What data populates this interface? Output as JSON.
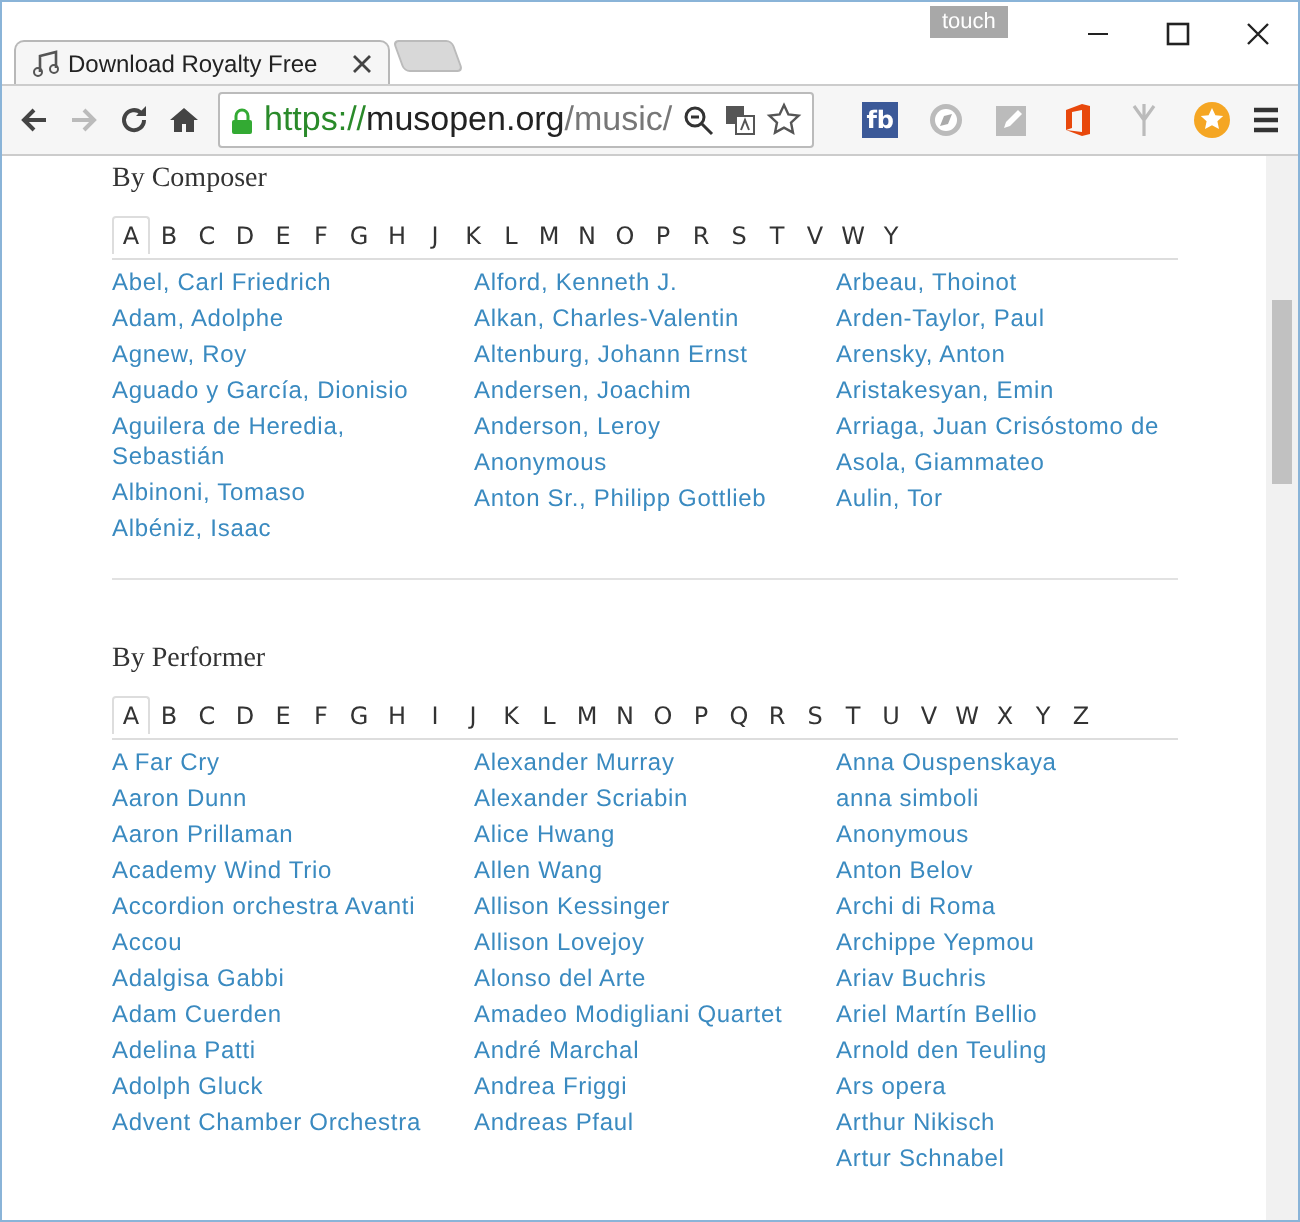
{
  "window": {
    "badge": "touch"
  },
  "tabs": [
    {
      "title": "Download Royalty Free",
      "selected": true
    }
  ],
  "toolbar": {
    "forward_disabled": true,
    "url": {
      "scheme": "https://",
      "host": "musopen.org",
      "path": "/music/"
    },
    "extensions": [
      {
        "kind": "text",
        "label": "fb"
      },
      {
        "kind": "compass"
      },
      {
        "kind": "edit"
      },
      {
        "kind": "office"
      },
      {
        "kind": "fork"
      },
      {
        "kind": "coin"
      }
    ]
  },
  "sections": [
    {
      "title": "By Composer",
      "letters": [
        {
          "label": "A",
          "selected": true
        },
        {
          "label": "B",
          "selected": false
        },
        {
          "label": "C",
          "selected": false
        },
        {
          "label": "D",
          "selected": false
        },
        {
          "label": "E",
          "selected": false
        },
        {
          "label": "F",
          "selected": false
        },
        {
          "label": "G",
          "selected": false
        },
        {
          "label": "H",
          "selected": false
        },
        {
          "label": "J",
          "selected": false
        },
        {
          "label": "K",
          "selected": false
        },
        {
          "label": "L",
          "selected": false
        },
        {
          "label": "M",
          "selected": false
        },
        {
          "label": "N",
          "selected": false
        },
        {
          "label": "O",
          "selected": false
        },
        {
          "label": "P",
          "selected": false
        },
        {
          "label": "R",
          "selected": false
        },
        {
          "label": "S",
          "selected": false
        },
        {
          "label": "T",
          "selected": false
        },
        {
          "label": "V",
          "selected": false
        },
        {
          "label": "W",
          "selected": false
        },
        {
          "label": "Y",
          "selected": false
        }
      ],
      "columns": [
        [
          "Abel, Carl Friedrich",
          "Adam, Adolphe",
          "Agnew, Roy",
          "Aguado y García, Dionisio",
          "Aguilera de Heredia, Sebastián",
          "Albinoni, Tomaso",
          "Albéniz, Isaac"
        ],
        [
          "Alford, Kenneth J.",
          "Alkan, Charles-Valentin",
          "Altenburg, Johann Ernst",
          "Andersen, Joachim",
          "Anderson, Leroy",
          "Anonymous",
          "Anton Sr., Philipp Gottlieb"
        ],
        [
          "Arbeau, Thoinot",
          "Arden-Taylor, Paul",
          "Arensky, Anton",
          "Aristakesyan, Emin",
          "Arriaga, Juan Crisóstomo de",
          "Asola, Giammateo",
          "Aulin, Tor"
        ]
      ]
    },
    {
      "title": "By Performer",
      "letters": [
        {
          "label": "A",
          "selected": true
        },
        {
          "label": "B",
          "selected": false
        },
        {
          "label": "C",
          "selected": false
        },
        {
          "label": "D",
          "selected": false
        },
        {
          "label": "E",
          "selected": false
        },
        {
          "label": "F",
          "selected": false
        },
        {
          "label": "G",
          "selected": false
        },
        {
          "label": "H",
          "selected": false
        },
        {
          "label": "I",
          "selected": false
        },
        {
          "label": "J",
          "selected": false
        },
        {
          "label": "K",
          "selected": false
        },
        {
          "label": "L",
          "selected": false
        },
        {
          "label": "M",
          "selected": false
        },
        {
          "label": "N",
          "selected": false
        },
        {
          "label": "O",
          "selected": false
        },
        {
          "label": "P",
          "selected": false
        },
        {
          "label": "Q",
          "selected": false
        },
        {
          "label": "R",
          "selected": false
        },
        {
          "label": "S",
          "selected": false
        },
        {
          "label": "T",
          "selected": false
        },
        {
          "label": "U",
          "selected": false
        },
        {
          "label": "V",
          "selected": false
        },
        {
          "label": "W",
          "selected": false
        },
        {
          "label": "X",
          "selected": false
        },
        {
          "label": "Y",
          "selected": false
        },
        {
          "label": "Z",
          "selected": false
        }
      ],
      "columns": [
        [
          "A Far Cry",
          "Aaron Dunn",
          "Aaron Prillaman",
          "Academy Wind Trio",
          "Accordion orchestra Avanti",
          "Accou",
          "Adalgisa Gabbi",
          "Adam Cuerden",
          "Adelina Patti",
          "Adolph Gluck",
          "Advent Chamber Orchestra"
        ],
        [
          "Alexander Murray",
          "Alexander Scriabin",
          "Alice Hwang",
          "Allen Wang",
          "Allison Kessinger",
          "Allison Lovejoy",
          "Alonso del Arte",
          "Amadeo Modigliani Quartet",
          "André Marchal",
          "Andrea Friggi",
          "Andreas Pfaul"
        ],
        [
          "Anna Ouspenskaya",
          "anna simboli",
          "Anonymous",
          "Anton Belov",
          "Archi di Roma",
          "Archippe Yepmou",
          "Ariav Buchris",
          "Ariel Martín Bellio",
          "Arnold den Teuling",
          "Ars opera",
          "Arthur Nikisch",
          "Artur Schnabel"
        ]
      ]
    }
  ]
}
